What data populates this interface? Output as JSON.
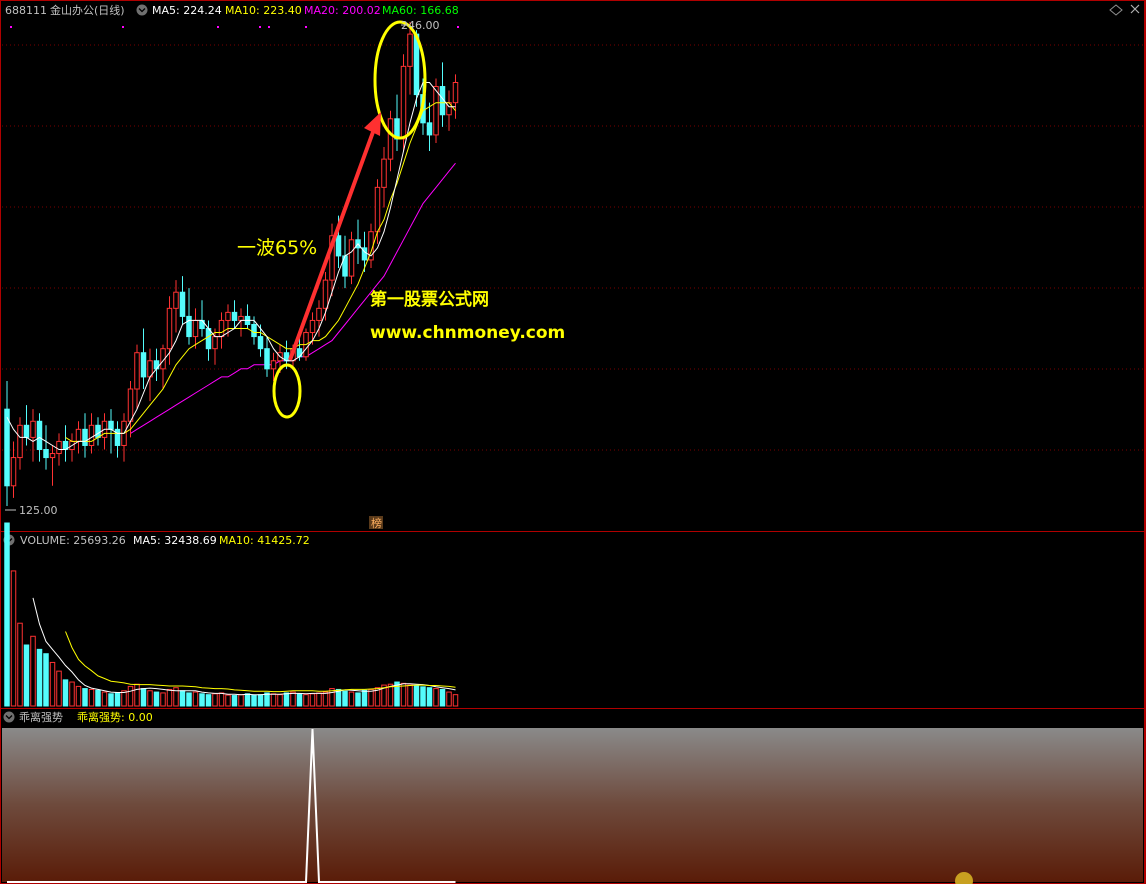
{
  "header": {
    "stock_code": "688111",
    "stock_name": "金山办公(日线)",
    "ma_values": [
      {
        "label": "MA5: 224.24",
        "color": "#ffffff"
      },
      {
        "label": "MA10: 223.40",
        "color": "#ffff00"
      },
      {
        "label": "MA20: 200.02",
        "color": "#ff00ff"
      },
      {
        "label": "MA60: 166.68",
        "color": "#00ff00"
      }
    ]
  },
  "price_panel": {
    "high_marker": "246.00",
    "low_marker": "125.00",
    "annotation_wave": "一波65%",
    "watermark_title": "第一股票公式网",
    "watermark_url": "www.chnmoney.com",
    "bang_badge": "榜"
  },
  "volume_panel": {
    "label": "VOLUME: 25693.26",
    "ma5_label": "MA5: 32438.69",
    "ma10_label": "MA10: 41425.72"
  },
  "indicator_panel": {
    "name": "乖离强势",
    "value_label": "乖离强势: 0.00"
  },
  "colors": {
    "up": "#ff3232",
    "down": "#54fcfc",
    "ma5": "#ffffff",
    "ma10": "#ffff00",
    "ma20": "#ff00ff",
    "ma60": "#00ff00",
    "frame": "#b00000"
  },
  "chart_data": {
    "type": "candlestick",
    "ylim": [
      125,
      246
    ],
    "candles": [
      {
        "o": 150,
        "h": 157,
        "l": 126,
        "c": 131
      },
      {
        "o": 131,
        "h": 142,
        "l": 128,
        "c": 138
      },
      {
        "o": 138,
        "h": 148,
        "l": 135,
        "c": 146
      },
      {
        "o": 146,
        "h": 151,
        "l": 141,
        "c": 143
      },
      {
        "o": 143,
        "h": 150,
        "l": 137,
        "c": 147
      },
      {
        "o": 147,
        "h": 149,
        "l": 137,
        "c": 140
      },
      {
        "o": 140,
        "h": 146,
        "l": 135,
        "c": 138
      },
      {
        "o": 138,
        "h": 141,
        "l": 131,
        "c": 139
      },
      {
        "o": 139,
        "h": 144,
        "l": 136,
        "c": 142
      },
      {
        "o": 142,
        "h": 146,
        "l": 137,
        "c": 140
      },
      {
        "o": 140,
        "h": 144,
        "l": 137,
        "c": 142
      },
      {
        "o": 142,
        "h": 147,
        "l": 139,
        "c": 145
      },
      {
        "o": 145,
        "h": 149,
        "l": 138,
        "c": 141
      },
      {
        "o": 141,
        "h": 149,
        "l": 139,
        "c": 146
      },
      {
        "o": 146,
        "h": 148,
        "l": 141,
        "c": 143
      },
      {
        "o": 143,
        "h": 149,
        "l": 140,
        "c": 147
      },
      {
        "o": 147,
        "h": 150,
        "l": 139,
        "c": 145
      },
      {
        "o": 145,
        "h": 147,
        "l": 138,
        "c": 141
      },
      {
        "o": 141,
        "h": 149,
        "l": 137,
        "c": 147
      },
      {
        "o": 147,
        "h": 157,
        "l": 143,
        "c": 155
      },
      {
        "o": 155,
        "h": 166,
        "l": 150,
        "c": 164
      },
      {
        "o": 164,
        "h": 170,
        "l": 155,
        "c": 158
      },
      {
        "o": 158,
        "h": 165,
        "l": 152,
        "c": 162
      },
      {
        "o": 162,
        "h": 165,
        "l": 157,
        "c": 160
      },
      {
        "o": 160,
        "h": 166,
        "l": 155,
        "c": 165
      },
      {
        "o": 165,
        "h": 178,
        "l": 161,
        "c": 175
      },
      {
        "o": 175,
        "h": 182,
        "l": 169,
        "c": 179
      },
      {
        "o": 179,
        "h": 183,
        "l": 171,
        "c": 173
      },
      {
        "o": 173,
        "h": 180,
        "l": 166,
        "c": 168
      },
      {
        "o": 168,
        "h": 175,
        "l": 165,
        "c": 172
      },
      {
        "o": 172,
        "h": 177,
        "l": 168,
        "c": 170
      },
      {
        "o": 170,
        "h": 172,
        "l": 162,
        "c": 165
      },
      {
        "o": 165,
        "h": 170,
        "l": 161,
        "c": 168
      },
      {
        "o": 168,
        "h": 174,
        "l": 165,
        "c": 172
      },
      {
        "o": 172,
        "h": 176,
        "l": 168,
        "c": 174
      },
      {
        "o": 174,
        "h": 177,
        "l": 170,
        "c": 172
      },
      {
        "o": 172,
        "h": 175,
        "l": 168,
        "c": 173
      },
      {
        "o": 173,
        "h": 176,
        "l": 170,
        "c": 171
      },
      {
        "o": 171,
        "h": 173,
        "l": 166,
        "c": 168
      },
      {
        "o": 168,
        "h": 171,
        "l": 163,
        "c": 165
      },
      {
        "o": 165,
        "h": 168,
        "l": 158,
        "c": 160
      },
      {
        "o": 160,
        "h": 164,
        "l": 157,
        "c": 162
      },
      {
        "o": 162,
        "h": 166,
        "l": 159,
        "c": 164
      },
      {
        "o": 164,
        "h": 167,
        "l": 160,
        "c": 162
      },
      {
        "o": 162,
        "h": 166,
        "l": 160,
        "c": 165
      },
      {
        "o": 165,
        "h": 168,
        "l": 162,
        "c": 163
      },
      {
        "o": 163,
        "h": 170,
        "l": 162,
        "c": 169
      },
      {
        "o": 169,
        "h": 174,
        "l": 166,
        "c": 172
      },
      {
        "o": 172,
        "h": 177,
        "l": 168,
        "c": 175
      },
      {
        "o": 175,
        "h": 184,
        "l": 172,
        "c": 182
      },
      {
        "o": 182,
        "h": 196,
        "l": 178,
        "c": 193
      },
      {
        "o": 193,
        "h": 198,
        "l": 185,
        "c": 188
      },
      {
        "o": 188,
        "h": 193,
        "l": 180,
        "c": 183
      },
      {
        "o": 183,
        "h": 194,
        "l": 181,
        "c": 192
      },
      {
        "o": 192,
        "h": 197,
        "l": 186,
        "c": 190
      },
      {
        "o": 190,
        "h": 194,
        "l": 184,
        "c": 187
      },
      {
        "o": 187,
        "h": 196,
        "l": 185,
        "c": 194
      },
      {
        "o": 194,
        "h": 207,
        "l": 191,
        "c": 205
      },
      {
        "o": 205,
        "h": 215,
        "l": 200,
        "c": 212
      },
      {
        "o": 212,
        "h": 224,
        "l": 209,
        "c": 222
      },
      {
        "o": 222,
        "h": 228,
        "l": 214,
        "c": 217
      },
      {
        "o": 217,
        "h": 238,
        "l": 214,
        "c": 235
      },
      {
        "o": 235,
        "h": 246,
        "l": 228,
        "c": 243
      },
      {
        "o": 243,
        "h": 244,
        "l": 225,
        "c": 228
      },
      {
        "o": 228,
        "h": 232,
        "l": 218,
        "c": 221
      },
      {
        "o": 221,
        "h": 226,
        "l": 214,
        "c": 218
      },
      {
        "o": 218,
        "h": 232,
        "l": 216,
        "c": 230
      },
      {
        "o": 230,
        "h": 236,
        "l": 220,
        "c": 223
      },
      {
        "o": 223,
        "h": 229,
        "l": 219,
        "c": 226
      },
      {
        "o": 226,
        "h": 233,
        "l": 222,
        "c": 231
      }
    ],
    "ma5": [
      148,
      145,
      143,
      143,
      142,
      143,
      142,
      141,
      140,
      140,
      141,
      142,
      142,
      143,
      144,
      145,
      145,
      144,
      144,
      147,
      150,
      154,
      158,
      160,
      162,
      164,
      167,
      171,
      172,
      172,
      172,
      170,
      168,
      168,
      169,
      170,
      172,
      172,
      172,
      170,
      168,
      165,
      163,
      162,
      162,
      163,
      165,
      167,
      170,
      174,
      179,
      184,
      188,
      189,
      191,
      189,
      188,
      190,
      194,
      200,
      207,
      214,
      221,
      227,
      231,
      231,
      229,
      227,
      225,
      225
    ],
    "ma10": [
      null,
      null,
      null,
      null,
      null,
      null,
      null,
      null,
      null,
      143,
      142,
      142,
      142,
      142,
      143,
      144,
      144,
      144,
      144,
      145,
      147,
      149,
      151,
      153,
      155,
      158,
      161,
      163,
      165,
      166,
      167,
      168,
      169,
      169,
      170,
      170,
      170,
      170,
      169,
      169,
      168,
      167,
      166,
      165,
      165,
      166,
      166,
      167,
      167,
      168,
      170,
      172,
      175,
      178,
      181,
      185,
      189,
      194,
      197,
      202,
      206,
      211,
      216,
      220,
      224,
      225,
      226,
      226,
      226,
      224
    ],
    "ma20": [
      null,
      null,
      null,
      null,
      null,
      null,
      null,
      null,
      null,
      null,
      null,
      null,
      null,
      null,
      null,
      null,
      null,
      null,
      null,
      144,
      145,
      146,
      147,
      148,
      149,
      150,
      151,
      152,
      153,
      154,
      155,
      156,
      157,
      158,
      158,
      159,
      160,
      160,
      161,
      161,
      161,
      161,
      162,
      162,
      162,
      163,
      163,
      164,
      165,
      166,
      167,
      169,
      171,
      173,
      175,
      177,
      179,
      181,
      183,
      186,
      189,
      192,
      195,
      198,
      201,
      203,
      205,
      207,
      209,
      211
    ],
    "volume": [
      420,
      310,
      190,
      140,
      160,
      130,
      120,
      100,
      80,
      60,
      55,
      45,
      40,
      38,
      36,
      32,
      28,
      30,
      35,
      45,
      50,
      40,
      35,
      32,
      30,
      38,
      42,
      35,
      30,
      32,
      28,
      26,
      28,
      30,
      25,
      24,
      26,
      28,
      25,
      26,
      30,
      28,
      26,
      30,
      32,
      28,
      26,
      28,
      30,
      32,
      40,
      38,
      34,
      32,
      30,
      36,
      38,
      42,
      48,
      50,
      55,
      52,
      48,
      46,
      44,
      42,
      40,
      38,
      32,
      26
    ],
    "vol_ma5": [
      null,
      null,
      null,
      null,
      248,
      188,
      148,
      130,
      112,
      93,
      78,
      60,
      47,
      41,
      38,
      35,
      32,
      31,
      31,
      34,
      38,
      40,
      41,
      40,
      38,
      36,
      35,
      35,
      35,
      35,
      32,
      30,
      29,
      29,
      27,
      27,
      26,
      27,
      26,
      26,
      27,
      27,
      27,
      28,
      29,
      29,
      28,
      29,
      29,
      29,
      31,
      34,
      37,
      36,
      35,
      34,
      34,
      36,
      41,
      45,
      48,
      51,
      51,
      50,
      49,
      47,
      44,
      42,
      40,
      37
    ],
    "vol_ma10": [
      null,
      null,
      null,
      null,
      null,
      null,
      null,
      null,
      null,
      171,
      134,
      107,
      92,
      81,
      69,
      63,
      57,
      55,
      53,
      50,
      49,
      49,
      49,
      48,
      47,
      46,
      46,
      46,
      45,
      44,
      42,
      41,
      40,
      40,
      39,
      37,
      36,
      35,
      34,
      34,
      34,
      33,
      33,
      34,
      35,
      35,
      35,
      35,
      34,
      34,
      35,
      36,
      37,
      38,
      38,
      38,
      39,
      40,
      42,
      44,
      45,
      46,
      47,
      48,
      48,
      47,
      47,
      46,
      45,
      43
    ],
    "indicator": [
      0,
      0,
      0,
      0,
      0,
      0,
      0,
      0,
      0,
      0,
      0,
      0,
      0,
      0,
      0,
      0,
      0,
      0,
      0,
      0,
      0,
      0,
      0,
      0,
      0,
      0,
      0,
      0,
      0,
      0,
      0,
      0,
      0,
      0,
      0,
      0,
      0,
      0,
      0,
      0,
      0,
      0,
      0,
      0,
      0,
      0,
      0,
      100,
      0,
      0,
      0,
      0,
      0,
      0,
      0,
      0,
      0,
      0,
      0,
      0,
      0,
      0,
      0,
      0,
      0,
      0,
      0,
      0,
      0,
      0
    ],
    "indicator_ylim": [
      0,
      100
    ]
  }
}
